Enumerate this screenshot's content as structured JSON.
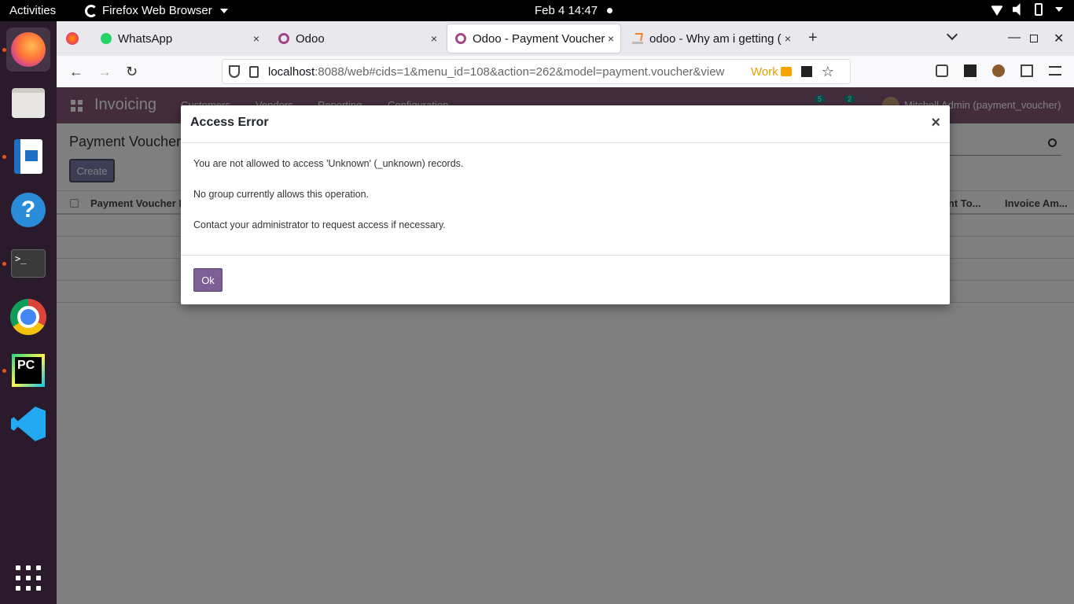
{
  "topbar": {
    "activities": "Activities",
    "app_menu": "Firefox Web Browser",
    "clock": "Feb 4  14:47"
  },
  "dock": {
    "apps": [
      "firefox-icon",
      "files-icon",
      "writer-icon",
      "help-icon",
      "terminal-icon",
      "chrome-icon",
      "pycharm-icon",
      "vscode-icon"
    ],
    "terminal_glyph": ">_",
    "pycharm_glyph": "PC"
  },
  "browser": {
    "tabs": [
      {
        "label": "WhatsApp",
        "icon": "whatsapp-icon",
        "close": "×"
      },
      {
        "label": "Odoo",
        "icon": "odoo-icon",
        "close": "×"
      },
      {
        "label": "Odoo - Payment Voucher",
        "icon": "odoo-icon",
        "close": "×",
        "active": true
      },
      {
        "label": "odoo - Why am i getting (",
        "icon": "stackoverflow-icon",
        "close": "×"
      }
    ],
    "new_tab": "+",
    "url_host": "localhost",
    "url_rest": ":8088/web#cids=1&menu_id=108&action=262&model=payment.voucher&view",
    "container_label": "Work"
  },
  "odoo": {
    "app_name": "Invoicing",
    "menu": [
      "Customers",
      "Vendors",
      "Reporting",
      "Configuration"
    ],
    "badges": [
      "5",
      "2"
    ],
    "user": "Mitchell Admin (payment_voucher)",
    "page_title": "Payment Voucher",
    "create_label": "Create",
    "columns": [
      "Payment Voucher N",
      "ount To...",
      "Invoice Am..."
    ]
  },
  "dialog": {
    "title": "Access Error",
    "close": "×",
    "lines": [
      "You are not allowed to access 'Unknown' (_unknown) records.",
      "No group currently allows this operation.",
      "Contact your administrator to request access if necessary."
    ],
    "ok_label": "Ok"
  }
}
